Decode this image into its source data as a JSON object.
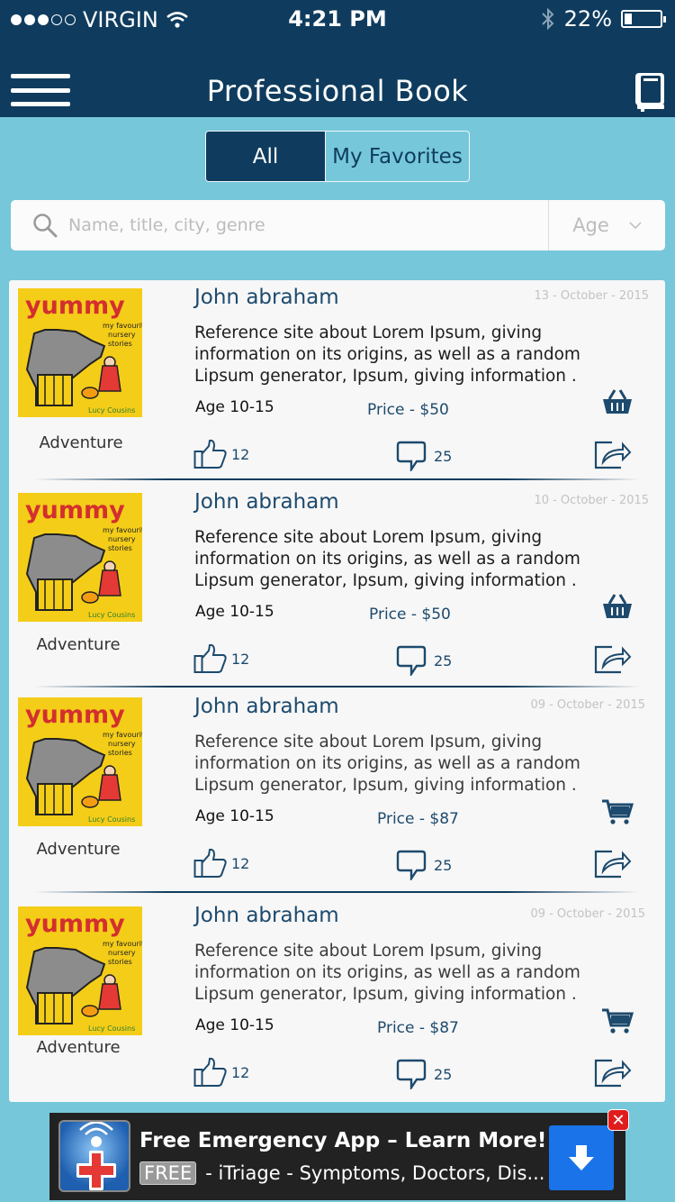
{
  "status": {
    "carrier": "VIRGIN",
    "time": "4:21 PM",
    "battery": "22%",
    "battery_level": 0.22
  },
  "header": {
    "title": "Professional Book"
  },
  "segments": {
    "all": "All",
    "favorites": "My Favorites"
  },
  "search": {
    "placeholder": "Name, title, city, genre",
    "age_filter": "Age"
  },
  "books": [
    {
      "genre": "Adventure",
      "author": "John abraham",
      "date": "13 - October -  2015",
      "description": "Reference site about Lorem Ipsum, giving information on its origins, as well as a random Lipsum generator, Ipsum, giving information .",
      "age": "Age 10-15",
      "price": "Price - $50",
      "likes": "12",
      "comments": "25",
      "cart_icon": "basket-icon"
    },
    {
      "genre": "Adventure",
      "author": "John abraham",
      "date": "10 - October -  2015",
      "description": "Reference site about Lorem Ipsum, giving information on its origins, as well as a random Lipsum generator, Ipsum, giving information .",
      "age": "Age 10-15",
      "price": "Price - $50",
      "likes": "12",
      "comments": "25",
      "cart_icon": "basket-icon"
    },
    {
      "genre": "Adventure",
      "author": "John abraham",
      "date": "09 - October -  2015",
      "description": "Reference site about Lorem Ipsum, giving information on its origins, as well as a random Lipsum generator, Ipsum, giving information .",
      "age": "Age 10-15",
      "price": "Price - $87",
      "likes": "12",
      "comments": "25",
      "cart_icon": "shopping-cart-icon"
    },
    {
      "genre": "Adventure",
      "author": "John abraham",
      "date": "09 - October -  2015",
      "description": "Reference site about Lorem Ipsum, giving information on its origins, as well as a random Lipsum generator, Ipsum, giving information .",
      "age": "Age 10-15",
      "price": "Price - $87",
      "likes": "12",
      "comments": "25",
      "cart_icon": "shopping-cart-icon"
    }
  ],
  "cover": {
    "title": "yummy",
    "subtitle": "my favourite nursery stories",
    "author": "Lucy Cousins"
  },
  "ad": {
    "headline": "Free Emergency App – Learn More!",
    "badge": "FREE",
    "text": "- iTriage - Symptoms, Doctors, Dis..."
  },
  "colors": {
    "header": "#0f3c5e",
    "background": "#76c7da",
    "accent": "#1d4a6d",
    "cover": "#f4cd18"
  }
}
